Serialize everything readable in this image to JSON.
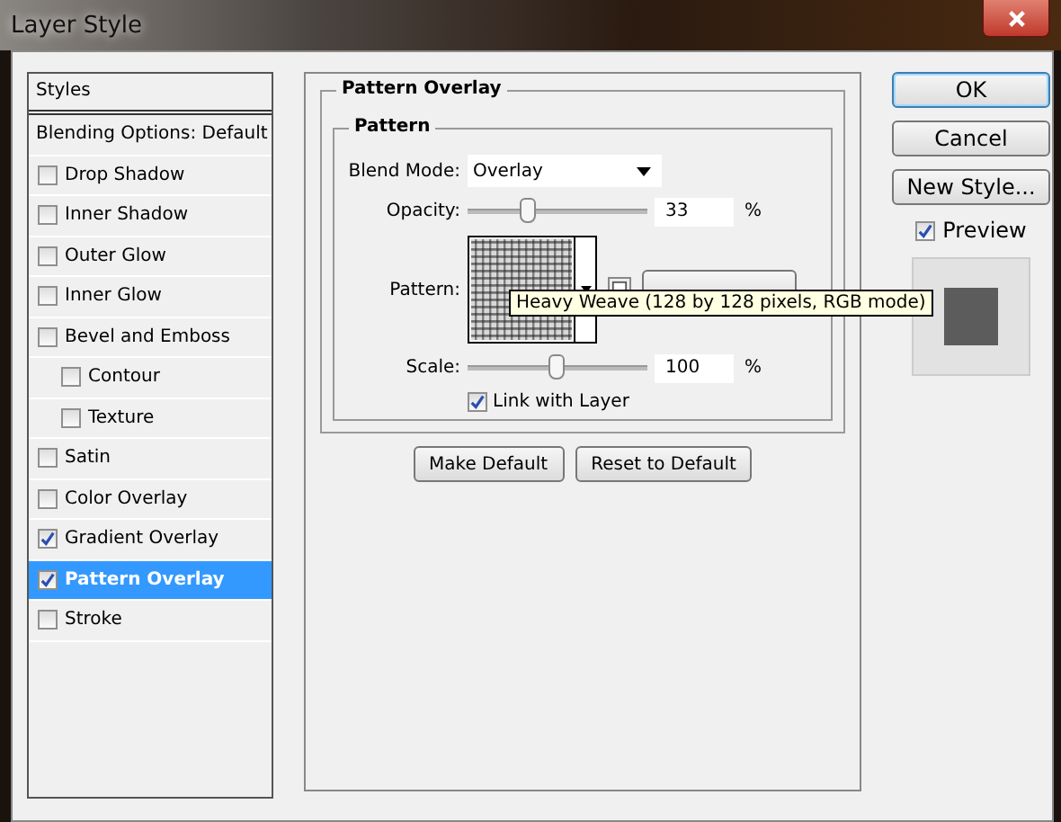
{
  "window": {
    "title": "Layer Style"
  },
  "styles_panel": {
    "header": "Styles",
    "items": [
      {
        "kind": "plain",
        "label": "Blending Options: Default",
        "selected": false
      },
      {
        "kind": "check",
        "label": "Drop Shadow",
        "checked": false,
        "selected": false
      },
      {
        "kind": "check",
        "label": "Inner Shadow",
        "checked": false,
        "selected": false
      },
      {
        "kind": "check",
        "label": "Outer Glow",
        "checked": false,
        "selected": false
      },
      {
        "kind": "check",
        "label": "Inner Glow",
        "checked": false,
        "selected": false
      },
      {
        "kind": "check",
        "label": "Bevel and Emboss",
        "checked": false,
        "selected": false,
        "children": [
          {
            "kind": "check",
            "label": "Contour",
            "checked": false,
            "selected": false
          },
          {
            "kind": "check",
            "label": "Texture",
            "checked": false,
            "selected": false
          }
        ]
      },
      {
        "kind": "check",
        "label": "Satin",
        "checked": false,
        "selected": false
      },
      {
        "kind": "check",
        "label": "Color Overlay",
        "checked": false,
        "selected": false
      },
      {
        "kind": "check",
        "label": "Gradient Overlay",
        "checked": true,
        "selected": false
      },
      {
        "kind": "check",
        "label": "Pattern Overlay",
        "checked": true,
        "selected": true
      },
      {
        "kind": "check",
        "label": "Stroke",
        "checked": false,
        "selected": false
      }
    ]
  },
  "pattern_overlay": {
    "title": "Pattern Overlay",
    "group": "Pattern",
    "blend_mode": {
      "label": "Blend Mode:",
      "value": "Overlay"
    },
    "opacity": {
      "label": "Opacity:",
      "level": 0.33,
      "value": "33",
      "unit": "%"
    },
    "pattern": {
      "label": "Pattern:",
      "tooltip": "Heavy Weave (128 by 128 pixels, RGB mode)"
    },
    "scale": {
      "label": "Scale:",
      "level": 0.49,
      "value": "100",
      "unit": "%"
    },
    "link_with_layer": {
      "label": "Link with Layer",
      "checked": true
    },
    "buttons": [
      "Make Default",
      "Reset to Default"
    ]
  },
  "actions": [
    {
      "label": "OK",
      "default": true
    },
    {
      "label": "Cancel",
      "default": false
    },
    {
      "label": "New Style...",
      "default": false
    }
  ],
  "preview": {
    "label": "Preview",
    "checked": true
  }
}
